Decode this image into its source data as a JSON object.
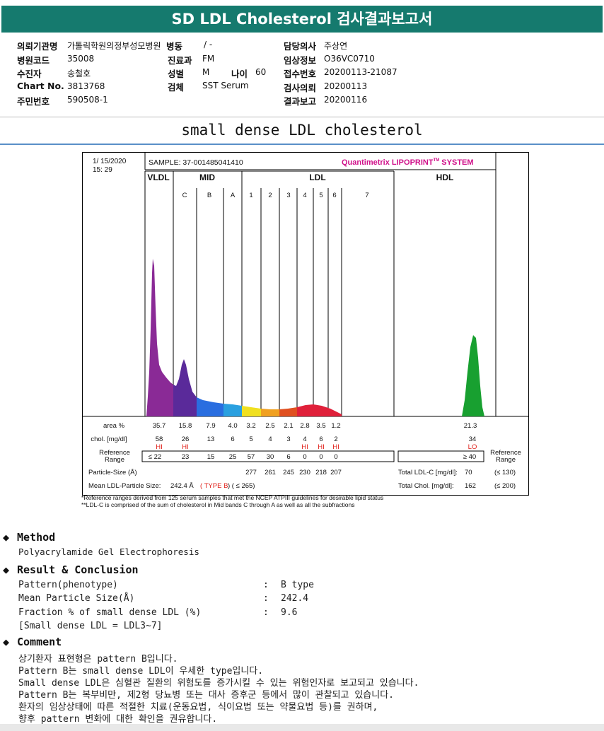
{
  "title": "SD LDL Cholesterol 검사결과보고서",
  "patient": {
    "institution_label": "의뢰기관명",
    "institution": "가톨릭학원의정부성모병원",
    "ward_label": "병동",
    "ward": "/ -",
    "doctor_label": "담당의사",
    "doctor": "주상연",
    "hospcode_label": "병원코드",
    "hospcode": "35008",
    "dept_label": "진료과",
    "dept": "FM",
    "clinical_label": "임상정보",
    "clinical": "O36VC0710",
    "examinee_label": "수진자",
    "examinee": "송철호",
    "sex_label": "성별",
    "sex": "M",
    "age_label": "나이",
    "age": "60",
    "receipt_label": "접수번호",
    "receipt": "20200113-21087",
    "chart_label": "Chart No.",
    "chart": "3813768",
    "specimen_label": "검체",
    "specimen": "SST Serum",
    "request_label": "검사의뢰",
    "request": "20200113",
    "id_label": "주민번호",
    "id": "590508-1",
    "report_label": "결과보고",
    "report": "20200116"
  },
  "section_title": "small dense LDL cholesterol",
  "lipoprint": {
    "date": "1/ 15/2020",
    "time": "15: 29",
    "sample": "SAMPLE:  37-001485041410",
    "brand": "Quantimetrix LIPOPRINT",
    "brand_tm": "TM",
    "brand_system": " SYSTEM",
    "groups": [
      "VLDL",
      "MID",
      "LDL",
      "HDL"
    ],
    "subbands": [
      "C",
      "B",
      "A",
      "1",
      "2",
      "3",
      "4",
      "5",
      "6",
      "7"
    ],
    "area_label": "area %",
    "area": [
      "35.7",
      "15.8",
      "7.9",
      "4.0",
      "3.2",
      "2.5",
      "2.1",
      "2.8",
      "3.5",
      "1.2",
      "21.3"
    ],
    "chol_label": "chol. [mg/dl]",
    "chol": [
      "58",
      "26",
      "13",
      "6",
      "5",
      "4",
      "3",
      "4",
      "6",
      "2",
      "34"
    ],
    "flags": [
      "HI",
      "HI",
      "",
      "",
      "",
      "",
      "",
      "HI",
      "HI",
      "HI",
      "LO"
    ],
    "ref_label": "Reference Range",
    "ref": [
      "≤ 22",
      "23",
      "15",
      "25",
      "57",
      "30",
      "6",
      "0",
      "0",
      "0"
    ],
    "ref_hdl": "≥ 40",
    "ref_label_right": "Reference Range",
    "particle_label": "Particle-Size (Å)",
    "particle": [
      "277",
      "261",
      "245",
      "230",
      "218",
      "207"
    ],
    "mean_label": "Mean LDL-Particle Size:",
    "mean_value": "242.4 Å",
    "mean_type": "( TYPE B",
    "mean_range": ") ( ≤ 265)",
    "total_ldl_label": "Total LDL-C [mg/dl]:",
    "total_ldl": "70",
    "total_ldl_range": "(≤ 130)",
    "total_chol_label": "Total Chol. [mg/dl]:",
    "total_chol": "162",
    "total_chol_range": "(≤ 200)",
    "footnote1": "*Reference ranges derived from 125 serum samples that met the NCEP ATPIII guidelines for desirable lipid status",
    "footnote2": "**LDL-C is comprised of the sum of cholesterol in Mid bands C through A as well as all the subfractions"
  },
  "method": {
    "heading": "Method",
    "text": "Polyacrylamide Gel Electrophoresis"
  },
  "result": {
    "heading": "Result & Conclusion",
    "rows": [
      {
        "label": "Pattern(phenotype)",
        "colon": ":",
        "value": "B type"
      },
      {
        "label": "Mean Particle Size(Å)",
        "colon": ":",
        "value": "242.4"
      },
      {
        "label": "Fraction % of small dense LDL (%)",
        "colon": ":",
        "value": "9.6"
      }
    ],
    "note": "[Small dense LDL = LDL3~7]"
  },
  "comment": {
    "heading": "Comment",
    "lines": [
      "상기환자 표현형은 pattern B입니다.",
      "Pattern B는 small dense LDL이 우세한 type입니다.",
      "Small dense LDL은 심혈관 질환의 위험도를 증가시킬 수 있는 위험인자로 보고되고 있습니다.",
      "Pattern B는 복부비만, 제2형 당뇨병 또는 대사 증후군 등에서 많이 관찰되고 있습니다.",
      "환자의 임상상태에 따른 적절한 치료(운동요법, 식이요법 또는 약물요법 등)를 권하며,",
      "향후 pattern 변화에 대한 확인을 권유합니다."
    ]
  },
  "colors": {
    "title_bg": "#157a6e",
    "vldl": "#8a2a96",
    "mid_c": "#5a2a9a",
    "mid_b": "#2a6ee0",
    "mid_a": "#2aa0e0",
    "ldl1": "#f0e020",
    "ldl2": "#f0a020",
    "ldl3": "#e05020",
    "ldl4": "#e0203a",
    "hdl": "#18a030",
    "flag": "#e0201a",
    "brand": "#d0108a"
  }
}
